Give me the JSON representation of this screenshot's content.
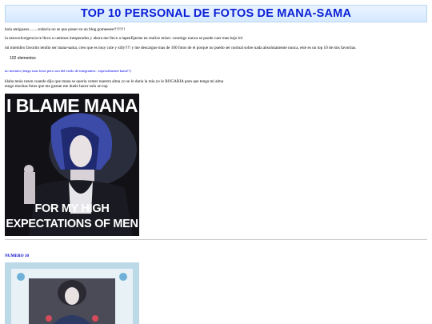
{
  "page": {
    "title": "TOP 10 PERSONAL DE FOTOS DE MANA-SAMA",
    "lines": [
      "hola amiguaos.........todavia no se que poner en un blog gomeeeee!!!!!!!!",
      "la neuroolvergencia te lleva a caminos inesperados y ahora me llevo a lapenfijarme en realixe mizer. conmigo nunca se puede caer mas bajo lol",
      "mi miembro favorito tendio ser mana-sama, creo que es muy cute y silly!!!! y me descargue mas de 100 fotos de el porque no puedo ser normal sobre nada absolutamente nunca, este es un top 10 de mis favoritas."
    ],
    "count": "102 elementos",
    "link": "no mientes (tengo mas fotos pero son del estilo de integrantes...especialmente kami!!)",
    "para2": [
      "klaha tenia razon cuando dijo que mana se queria comer nuestra alma yo se lo daria la mia yo le ROGARIA para que tenga mi alma",
      "tengo muchas fotos que me gustan me duele hacer solo un top"
    ],
    "image1": {
      "top_text": "I BLAME MANA",
      "bottom_line1": "FOR MY HIGH",
      "bottom_line2": "EXPECTATIONS OF MEN"
    },
    "section_label": "NUMERO 10"
  },
  "colors": {
    "title": "#0a1fd6",
    "link": "#0000ee",
    "section": "#0000cc"
  }
}
